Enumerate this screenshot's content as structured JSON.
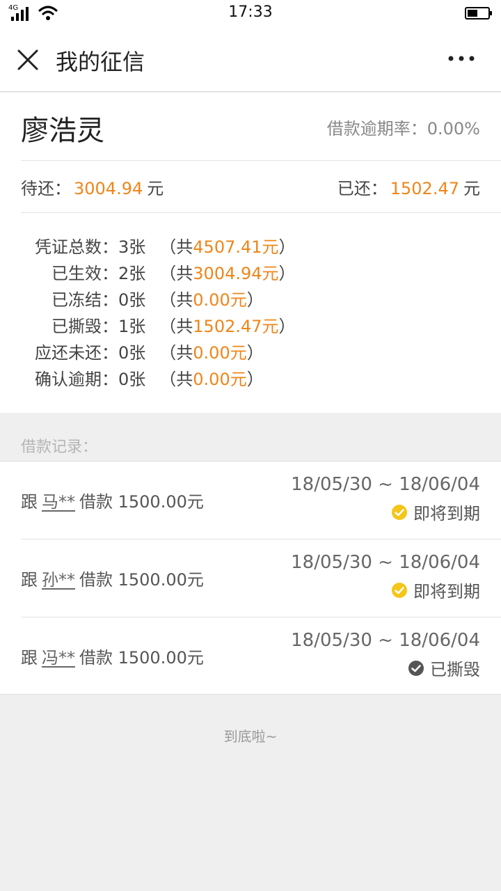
{
  "status_bar": {
    "network": "4G",
    "time": "17:33"
  },
  "nav": {
    "title": "我的征信",
    "close_icon": "close-icon",
    "more_icon": "more-icon"
  },
  "summary": {
    "name": "廖浩灵",
    "overdue_rate": "借款逾期率：0.00%",
    "pending_label": "待还：",
    "pending_amount": "3004.94",
    "pending_unit": "元",
    "paid_label": "已还：",
    "paid_amount": "1502.47",
    "paid_unit": "元"
  },
  "vouchers": [
    {
      "label": "凭证总数：",
      "count": "3张",
      "prefix": "（共",
      "amount": "4507.41元",
      "suffix": "）"
    },
    {
      "label": "已生效：",
      "count": "2张",
      "prefix": "（共",
      "amount": "3004.94元",
      "suffix": "）"
    },
    {
      "label": "已冻结：",
      "count": "0张",
      "prefix": "（共",
      "amount": "0.00元",
      "suffix": "）"
    },
    {
      "label": "已撕毁：",
      "count": "1张",
      "prefix": "（共",
      "amount": "1502.47元",
      "suffix": "）"
    },
    {
      "label": "应还未还：",
      "count": "0张",
      "prefix": "（共",
      "amount": "0.00元",
      "suffix": "）"
    },
    {
      "label": "确认逾期：",
      "count": "0张",
      "prefix": "（共",
      "amount": "0.00元",
      "suffix": "）"
    }
  ],
  "records_header": "借款记录：",
  "records": [
    {
      "prefix": "跟",
      "lender": "马**",
      "desc": "借款 1500.00元",
      "date": "18/05/30 ~ 18/06/04",
      "status": "即将到期",
      "status_color": "#f5c518",
      "status_icon": "check-circle-icon"
    },
    {
      "prefix": "跟",
      "lender": "孙**",
      "desc": "借款 1500.00元",
      "date": "18/05/30 ~ 18/06/04",
      "status": "即将到期",
      "status_color": "#f5c518",
      "status_icon": "check-circle-icon"
    },
    {
      "prefix": "跟",
      "lender": "冯**",
      "desc": "借款 1500.00元",
      "date": "18/05/30 ~ 18/06/04",
      "status": "已撕毁",
      "status_color": "#555555",
      "status_icon": "check-circle-icon"
    }
  ],
  "footer": "到底啦~",
  "colors": {
    "accent_orange": "#f08519",
    "warning_yellow": "#f5c518"
  }
}
